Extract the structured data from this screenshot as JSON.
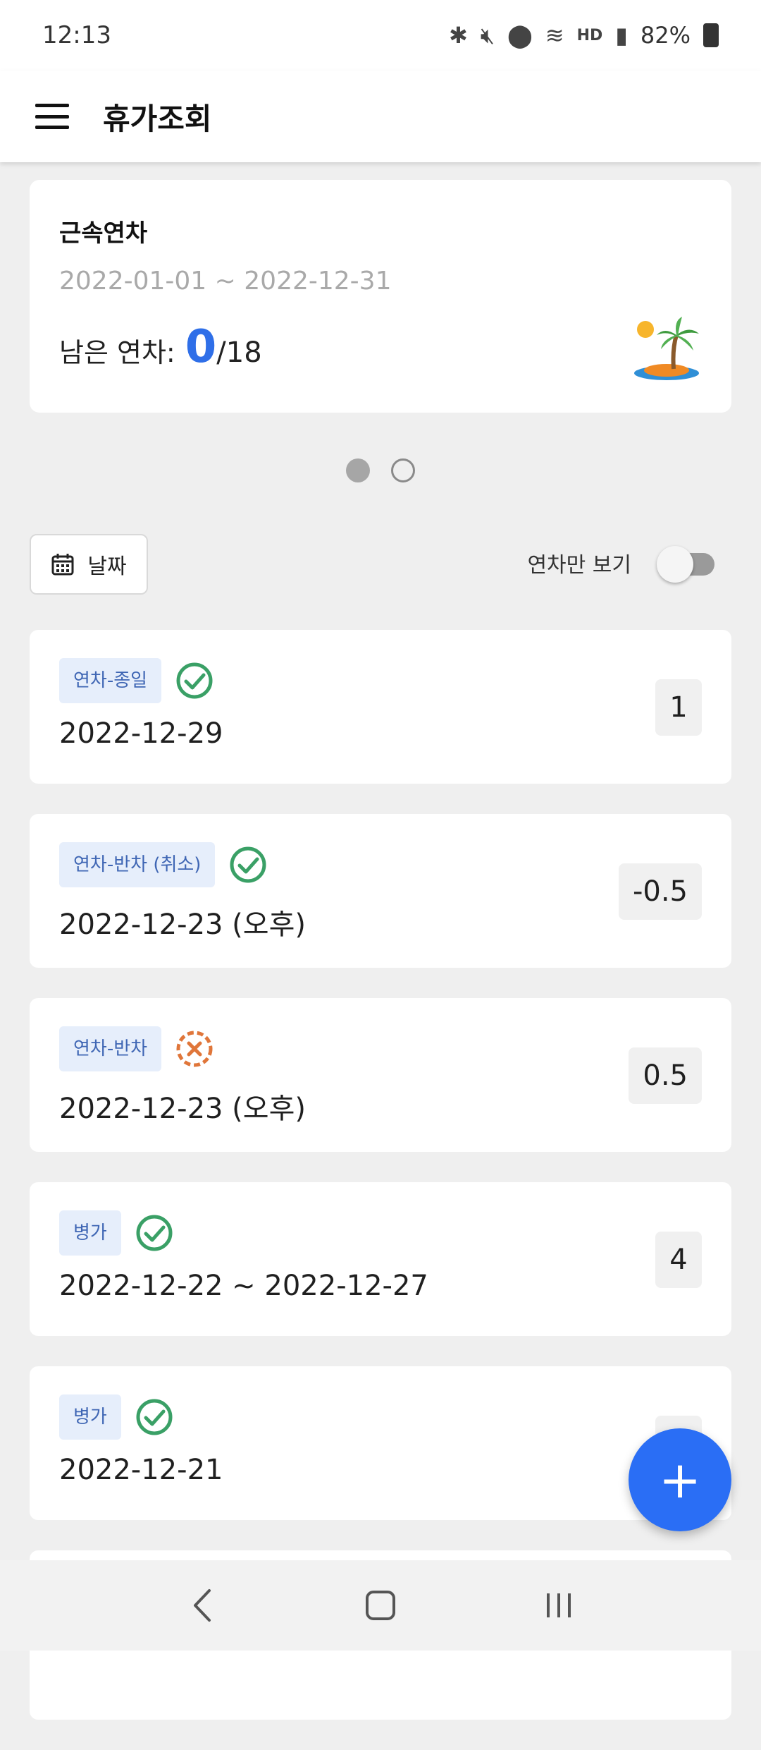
{
  "status_bar": {
    "time": "12:13",
    "battery": "82%",
    "icons": [
      "bluetooth-icon",
      "mute-icon",
      "location-icon",
      "wifi-icon",
      "hd-voice-icon",
      "signal-icon",
      "battery-icon"
    ]
  },
  "app_bar": {
    "title": "휴가조회"
  },
  "summary": {
    "title": "근속연차",
    "period": "2022-01-01 ~ 2022-12-31",
    "remaining_label": "남은 연차:",
    "remaining": "0",
    "total": "/18"
  },
  "pager": {
    "current": 1,
    "total": 2
  },
  "filter": {
    "date_button": "날짜",
    "annual_only_label": "연차만 보기",
    "annual_only_on": false
  },
  "leaves": [
    {
      "type": "연차-종일",
      "status": "approved",
      "date": "2022-12-29",
      "days": "1"
    },
    {
      "type": "연차-반차 (취소)",
      "status": "approved",
      "date": "2022-12-23 (오후)",
      "days": "-0.5"
    },
    {
      "type": "연차-반차",
      "status": "cancelled",
      "date": "2022-12-23 (오후)",
      "days": "0.5"
    },
    {
      "type": "병가",
      "status": "approved",
      "date": "2022-12-22 ~ 2022-12-27",
      "days": "4"
    },
    {
      "type": "병가",
      "status": "approved",
      "date": "2022-12-21",
      "days": ""
    }
  ],
  "fab": {
    "label": "+"
  },
  "colors": {
    "accent": "#2a6ef5",
    "approved": "#3aa066",
    "cancelled": "#e0763a",
    "tag_bg": "#e6eefb",
    "tag_text": "#3f66b4"
  }
}
